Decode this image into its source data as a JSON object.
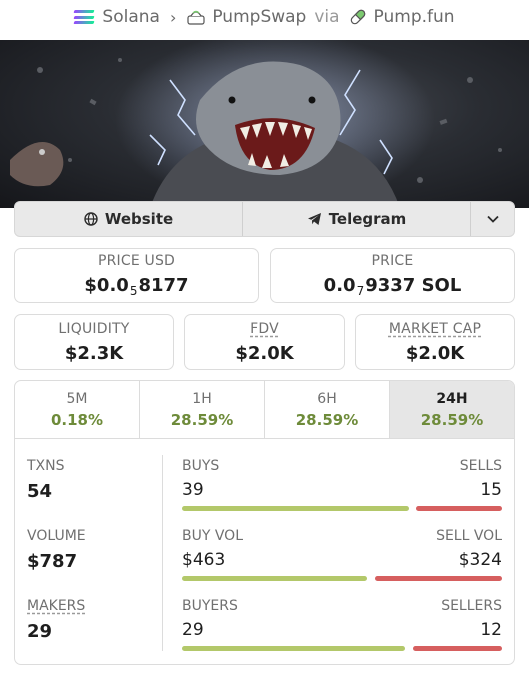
{
  "breadcrumb": {
    "chain": "Solana",
    "dex": "PumpSwap",
    "via": "via",
    "launchpad": "Pump.fun"
  },
  "links": {
    "website": "Website",
    "telegram": "Telegram"
  },
  "price_usd": {
    "label": "PRICE USD",
    "prefix": "$0.0",
    "zeros": "5",
    "digits": "8177"
  },
  "price_native": {
    "label": "PRICE",
    "prefix": "0.0",
    "zeros": "7",
    "digits": "9337 SOL"
  },
  "liquidity": {
    "label": "LIQUIDITY",
    "value": "$2.3K"
  },
  "fdv": {
    "label": "FDV",
    "value": "$2.0K"
  },
  "market_cap": {
    "label": "MARKET CAP",
    "value": "$2.0K"
  },
  "periods": [
    {
      "label": "5M",
      "change": "0.18%"
    },
    {
      "label": "1H",
      "change": "28.59%"
    },
    {
      "label": "6H",
      "change": "28.59%"
    },
    {
      "label": "24H",
      "change": "28.59%",
      "active": true
    }
  ],
  "metrics": {
    "txns": {
      "label": "TXNS",
      "value": "54"
    },
    "volume": {
      "label": "VOLUME",
      "value": "$787"
    },
    "makers": {
      "label": "MAKERS",
      "value": "29"
    }
  },
  "splits": {
    "txns": {
      "left_label": "BUYS",
      "left_value": "39",
      "right_label": "SELLS",
      "right_value": "15",
      "left_share": 0.72
    },
    "volume": {
      "left_label": "BUY VOL",
      "left_value": "$463",
      "right_label": "SELL VOL",
      "right_value": "$324",
      "left_share": 0.59
    },
    "makers": {
      "left_label": "BUYERS",
      "right_label": "SELLERS",
      "left_value": "29",
      "right_value": "12",
      "left_share": 0.71
    }
  },
  "colors": {
    "positive": "#6e8b3a",
    "buy_bar": "#b3c86a",
    "sell_bar": "#d65f5f"
  }
}
